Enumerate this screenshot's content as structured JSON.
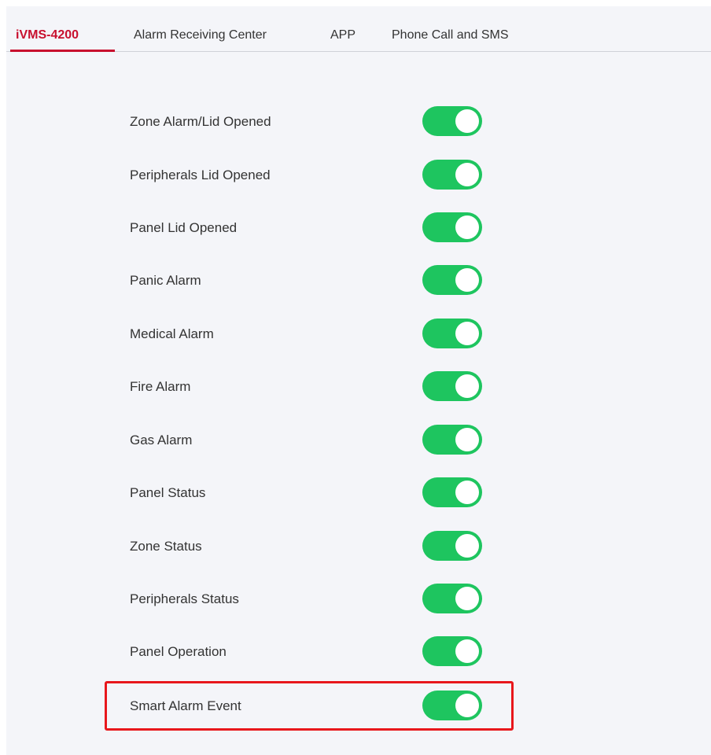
{
  "tabs": [
    {
      "label": "iVMS-4200",
      "active": true
    },
    {
      "label": "Alarm Receiving Center",
      "active": false
    },
    {
      "label": "APP",
      "active": false
    },
    {
      "label": "Phone Call and SMS",
      "active": false
    }
  ],
  "settings": [
    {
      "label": "Zone Alarm/Lid Opened",
      "enabled": true
    },
    {
      "label": "Peripherals Lid Opened",
      "enabled": true
    },
    {
      "label": "Panel Lid Opened",
      "enabled": true
    },
    {
      "label": "Panic Alarm",
      "enabled": true
    },
    {
      "label": "Medical Alarm",
      "enabled": true
    },
    {
      "label": "Fire Alarm",
      "enabled": true
    },
    {
      "label": "Gas Alarm",
      "enabled": true
    },
    {
      "label": "Panel Status",
      "enabled": true
    },
    {
      "label": "Zone Status",
      "enabled": true
    },
    {
      "label": "Peripherals Status",
      "enabled": true
    },
    {
      "label": "Panel Operation",
      "enabled": true
    },
    {
      "label": "Smart Alarm Event",
      "enabled": true
    }
  ],
  "colors": {
    "accent": "#c8102e",
    "toggle_on": "#1ec55f",
    "highlight": "#e8171c"
  }
}
